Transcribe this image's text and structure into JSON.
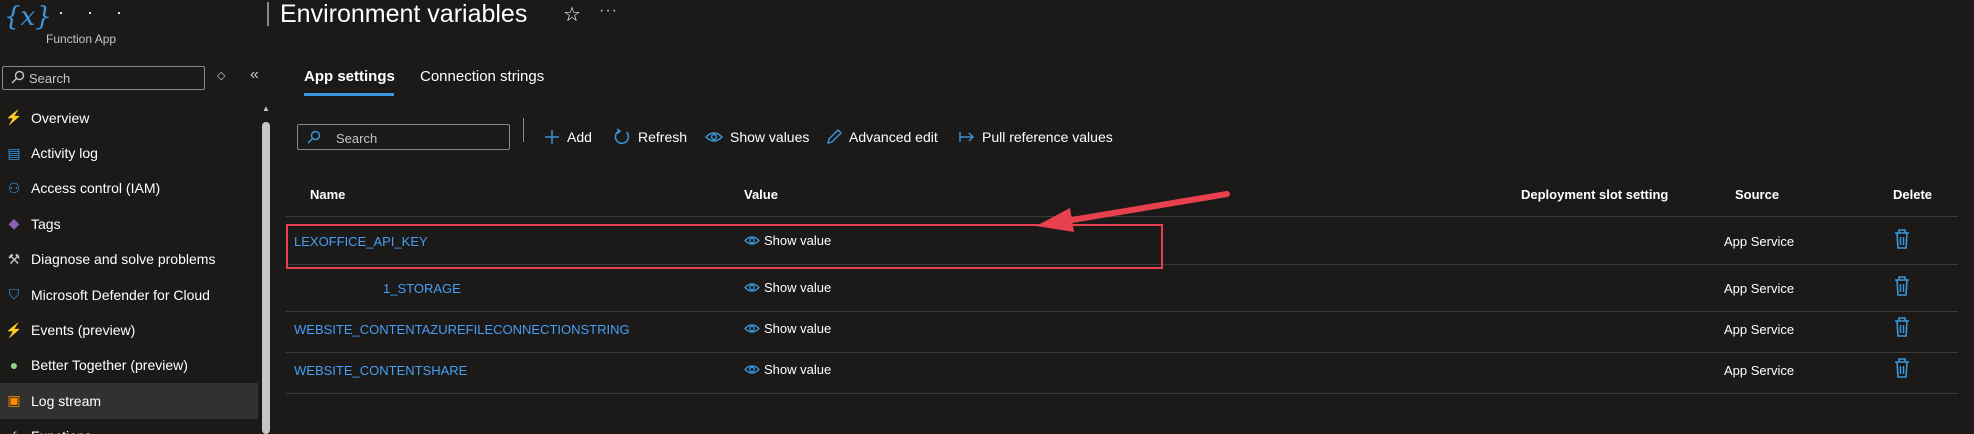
{
  "header": {
    "app_icon_text": "{x}",
    "app_name": "· · ·",
    "app_type": "Function App",
    "page_title": "Environment variables",
    "favorite_icon": "star-icon",
    "more_icon": "more-icon"
  },
  "nav": {
    "search_placeholder": "Search",
    "items": [
      {
        "label": "Overview",
        "icon": "lightning-icon",
        "color": "#f7c948"
      },
      {
        "label": "Activity log",
        "icon": "document-icon",
        "color": "#3a96dd"
      },
      {
        "label": "Access control (IAM)",
        "icon": "people-icon",
        "color": "#3a96dd"
      },
      {
        "label": "Tags",
        "icon": "tag-icon",
        "color": "#8764b8"
      },
      {
        "label": "Diagnose and solve problems",
        "icon": "wrench-icon",
        "color": "#c8c6c4"
      },
      {
        "label": "Microsoft Defender for Cloud",
        "icon": "shield-icon",
        "color": "#3a96dd"
      },
      {
        "label": "Events (preview)",
        "icon": "bolt-icon",
        "color": "#f7c948"
      },
      {
        "label": "Better Together (preview)",
        "icon": "lightbulb-icon",
        "color": "#8cd47e"
      },
      {
        "label": "Log stream",
        "icon": "log-stream-icon",
        "color": "#ff8c00"
      },
      {
        "label": "Functions",
        "icon": "functions-icon",
        "color": "#c8c6c4"
      }
    ],
    "selected_index": 8
  },
  "tabs": {
    "app_settings": "App settings",
    "connection_strings": "Connection strings",
    "active": "app_settings"
  },
  "toolbar": {
    "search_placeholder": "Search",
    "add": "Add",
    "refresh": "Refresh",
    "show_values": "Show values",
    "advanced_edit": "Advanced edit",
    "pull_reference_values": "Pull reference values"
  },
  "table": {
    "columns": {
      "name": "Name",
      "value": "Value",
      "deployment_slot_setting": "Deployment slot setting",
      "source": "Source",
      "delete": "Delete"
    },
    "rows": [
      {
        "name": "LEXOFFICE_API_KEY",
        "value": "Show value",
        "source": "App Service",
        "highlighted": true
      },
      {
        "name": "1_STORAGE",
        "value": "Show value",
        "source": "App Service",
        "highlighted": false
      },
      {
        "name": "WEBSITE_CONTENTAZUREFILECONNECTIONSTRING",
        "value": "Show value",
        "source": "App Service",
        "highlighted": false
      },
      {
        "name": "WEBSITE_CONTENTSHARE",
        "value": "Show value",
        "source": "App Service",
        "highlighted": false
      }
    ]
  },
  "colors": {
    "background": "#1b1a19",
    "accent": "#3a96dd",
    "link": "#479ef5",
    "annotation": "#e8404f"
  }
}
